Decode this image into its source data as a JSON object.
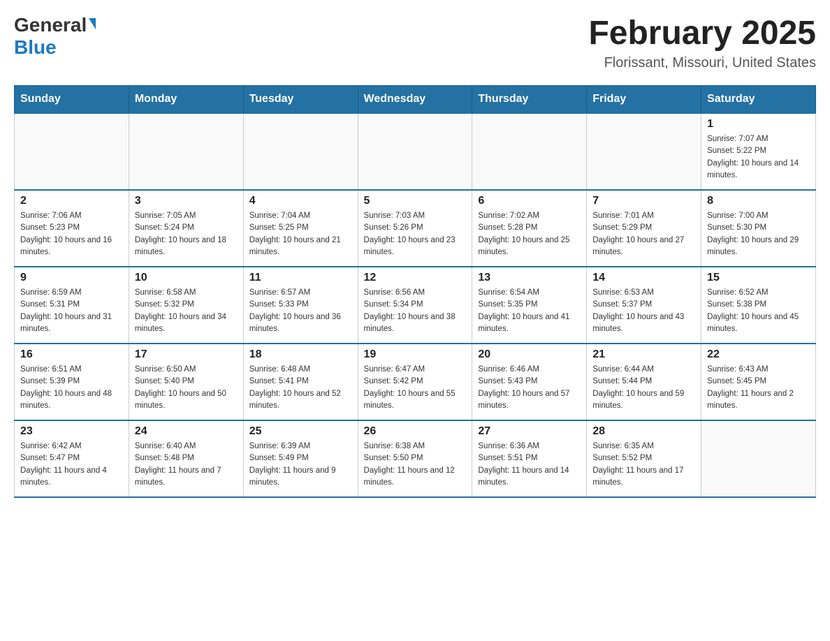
{
  "header": {
    "logo": {
      "general": "General",
      "blue": "Blue"
    },
    "title": "February 2025",
    "location": "Florissant, Missouri, United States"
  },
  "weekdays": [
    "Sunday",
    "Monday",
    "Tuesday",
    "Wednesday",
    "Thursday",
    "Friday",
    "Saturday"
  ],
  "weeks": [
    [
      {
        "day": "",
        "info": ""
      },
      {
        "day": "",
        "info": ""
      },
      {
        "day": "",
        "info": ""
      },
      {
        "day": "",
        "info": ""
      },
      {
        "day": "",
        "info": ""
      },
      {
        "day": "",
        "info": ""
      },
      {
        "day": "1",
        "info": "Sunrise: 7:07 AM\nSunset: 5:22 PM\nDaylight: 10 hours and 14 minutes."
      }
    ],
    [
      {
        "day": "2",
        "info": "Sunrise: 7:06 AM\nSunset: 5:23 PM\nDaylight: 10 hours and 16 minutes."
      },
      {
        "day": "3",
        "info": "Sunrise: 7:05 AM\nSunset: 5:24 PM\nDaylight: 10 hours and 18 minutes."
      },
      {
        "day": "4",
        "info": "Sunrise: 7:04 AM\nSunset: 5:25 PM\nDaylight: 10 hours and 21 minutes."
      },
      {
        "day": "5",
        "info": "Sunrise: 7:03 AM\nSunset: 5:26 PM\nDaylight: 10 hours and 23 minutes."
      },
      {
        "day": "6",
        "info": "Sunrise: 7:02 AM\nSunset: 5:28 PM\nDaylight: 10 hours and 25 minutes."
      },
      {
        "day": "7",
        "info": "Sunrise: 7:01 AM\nSunset: 5:29 PM\nDaylight: 10 hours and 27 minutes."
      },
      {
        "day": "8",
        "info": "Sunrise: 7:00 AM\nSunset: 5:30 PM\nDaylight: 10 hours and 29 minutes."
      }
    ],
    [
      {
        "day": "9",
        "info": "Sunrise: 6:59 AM\nSunset: 5:31 PM\nDaylight: 10 hours and 31 minutes."
      },
      {
        "day": "10",
        "info": "Sunrise: 6:58 AM\nSunset: 5:32 PM\nDaylight: 10 hours and 34 minutes."
      },
      {
        "day": "11",
        "info": "Sunrise: 6:57 AM\nSunset: 5:33 PM\nDaylight: 10 hours and 36 minutes."
      },
      {
        "day": "12",
        "info": "Sunrise: 6:56 AM\nSunset: 5:34 PM\nDaylight: 10 hours and 38 minutes."
      },
      {
        "day": "13",
        "info": "Sunrise: 6:54 AM\nSunset: 5:35 PM\nDaylight: 10 hours and 41 minutes."
      },
      {
        "day": "14",
        "info": "Sunrise: 6:53 AM\nSunset: 5:37 PM\nDaylight: 10 hours and 43 minutes."
      },
      {
        "day": "15",
        "info": "Sunrise: 6:52 AM\nSunset: 5:38 PM\nDaylight: 10 hours and 45 minutes."
      }
    ],
    [
      {
        "day": "16",
        "info": "Sunrise: 6:51 AM\nSunset: 5:39 PM\nDaylight: 10 hours and 48 minutes."
      },
      {
        "day": "17",
        "info": "Sunrise: 6:50 AM\nSunset: 5:40 PM\nDaylight: 10 hours and 50 minutes."
      },
      {
        "day": "18",
        "info": "Sunrise: 6:48 AM\nSunset: 5:41 PM\nDaylight: 10 hours and 52 minutes."
      },
      {
        "day": "19",
        "info": "Sunrise: 6:47 AM\nSunset: 5:42 PM\nDaylight: 10 hours and 55 minutes."
      },
      {
        "day": "20",
        "info": "Sunrise: 6:46 AM\nSunset: 5:43 PM\nDaylight: 10 hours and 57 minutes."
      },
      {
        "day": "21",
        "info": "Sunrise: 6:44 AM\nSunset: 5:44 PM\nDaylight: 10 hours and 59 minutes."
      },
      {
        "day": "22",
        "info": "Sunrise: 6:43 AM\nSunset: 5:45 PM\nDaylight: 11 hours and 2 minutes."
      }
    ],
    [
      {
        "day": "23",
        "info": "Sunrise: 6:42 AM\nSunset: 5:47 PM\nDaylight: 11 hours and 4 minutes."
      },
      {
        "day": "24",
        "info": "Sunrise: 6:40 AM\nSunset: 5:48 PM\nDaylight: 11 hours and 7 minutes."
      },
      {
        "day": "25",
        "info": "Sunrise: 6:39 AM\nSunset: 5:49 PM\nDaylight: 11 hours and 9 minutes."
      },
      {
        "day": "26",
        "info": "Sunrise: 6:38 AM\nSunset: 5:50 PM\nDaylight: 11 hours and 12 minutes."
      },
      {
        "day": "27",
        "info": "Sunrise: 6:36 AM\nSunset: 5:51 PM\nDaylight: 11 hours and 14 minutes."
      },
      {
        "day": "28",
        "info": "Sunrise: 6:35 AM\nSunset: 5:52 PM\nDaylight: 11 hours and 17 minutes."
      },
      {
        "day": "",
        "info": ""
      }
    ]
  ]
}
